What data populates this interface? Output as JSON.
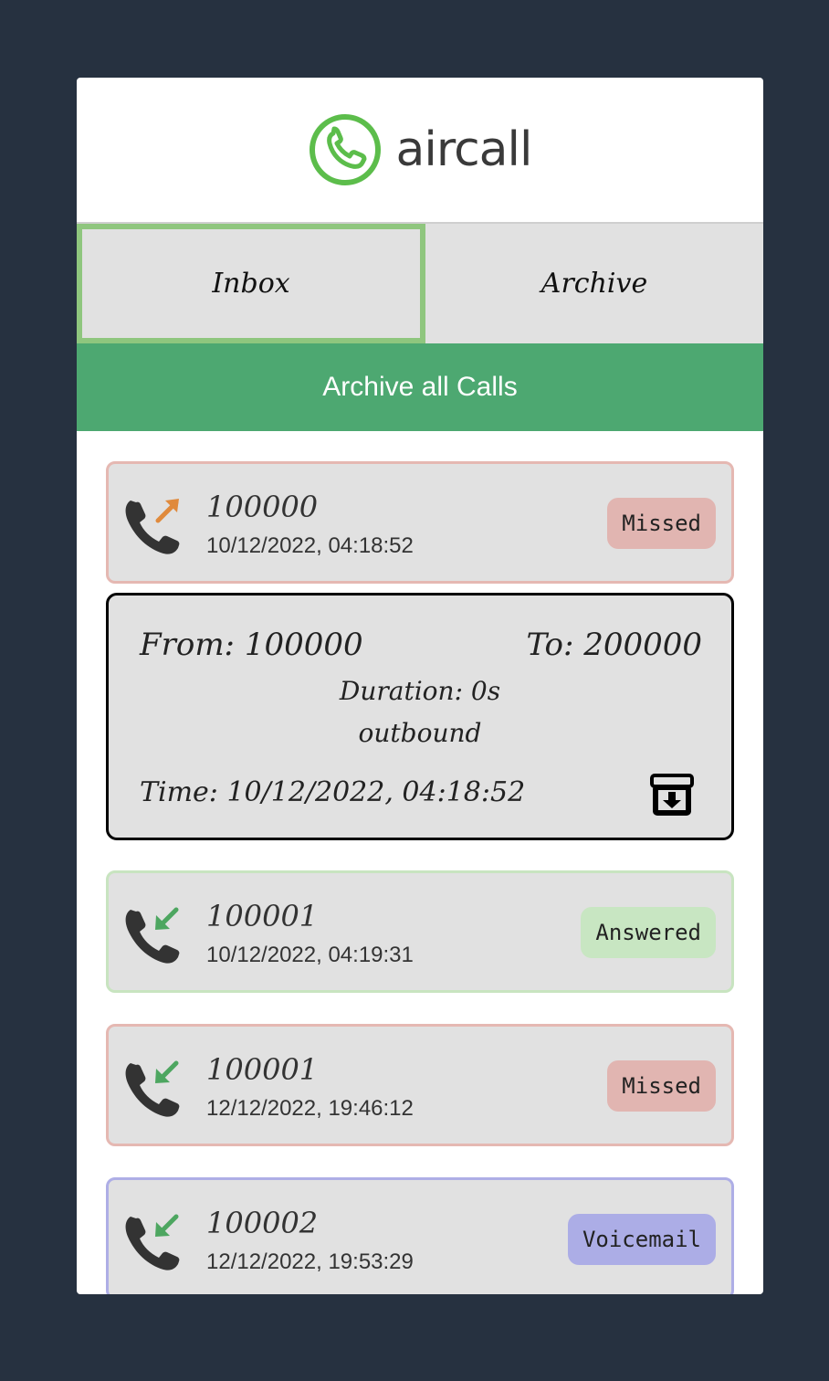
{
  "brand": {
    "name": "aircall",
    "color": "#5cbd4b"
  },
  "tabs": [
    {
      "label": "Inbox",
      "active": true
    },
    {
      "label": "Archive",
      "active": false
    }
  ],
  "archive_all_label": "Archive all Calls",
  "calls": [
    {
      "number": "100000",
      "time": "10/12/2022, 04:18:52",
      "status": "Missed",
      "direction_icon": "outgoing-arrow-icon"
    },
    {
      "number": "100001",
      "time": "10/12/2022, 04:19:31",
      "status": "Answered",
      "direction_icon": "incoming-arrow-icon"
    },
    {
      "number": "100001",
      "time": "12/12/2022, 19:46:12",
      "status": "Missed",
      "direction_icon": "incoming-arrow-icon"
    },
    {
      "number": "100002",
      "time": "12/12/2022, 19:53:29",
      "status": "Voicemail",
      "direction_icon": "incoming-arrow-icon"
    }
  ],
  "detail": {
    "from": "From: 100000",
    "to": "To: 200000",
    "duration": "Duration: 0s",
    "direction": "outbound",
    "time": "Time: 10/12/2022, 04:18:52"
  },
  "colors": {
    "background": "#263140",
    "active_tab_border": "#8fc67e",
    "archive_bar": "#4da871",
    "missed": "#e1b5b1",
    "answered": "#c8e6c2",
    "voicemail": "#acade6",
    "outgoing_arrow": "#e08a3c",
    "incoming_arrow": "#4da660"
  }
}
